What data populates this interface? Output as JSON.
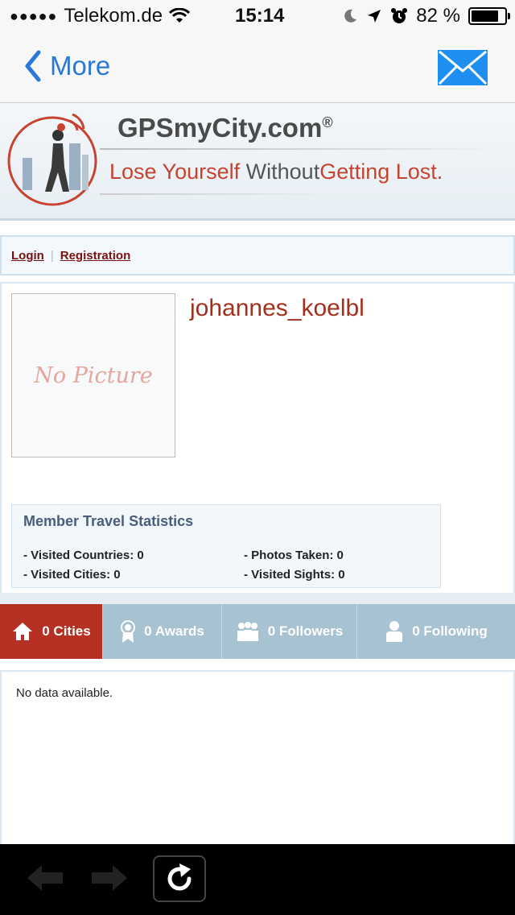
{
  "status_bar": {
    "carrier": "Telekom.de",
    "time": "15:14",
    "battery_percent_label": "82 %",
    "battery_level": 0.82
  },
  "nav": {
    "back_label": "More",
    "mail_icon": "mail-icon"
  },
  "banner": {
    "brand": "GPSmyCity.com",
    "brand_mark": "®",
    "tagline_start": "Lose Yourself",
    "tagline_mid": "Without",
    "tagline_end": "Getting Lost."
  },
  "auth": {
    "login_label": "Login",
    "separator": "|",
    "registration_label": "Registration"
  },
  "profile": {
    "no_picture_label": "No Picture",
    "username": "johannes_koelbl",
    "stats_title": "Member Travel Statistics",
    "visited_countries": "- Visited Countries: 0",
    "visited_cities": "- Visited Cities: 0",
    "photos_taken": "- Photos Taken: 0",
    "visited_sights": "- Visited Sights: 0"
  },
  "tabs": [
    {
      "label": "0 Cities",
      "icon": "home-icon",
      "active": true
    },
    {
      "label": "0 Awards",
      "icon": "award-icon",
      "active": false
    },
    {
      "label": "0 Followers",
      "icon": "followers-icon",
      "active": false
    },
    {
      "label": "0 Following",
      "icon": "following-icon",
      "active": false
    }
  ],
  "content": {
    "empty_message": "No data available."
  },
  "colors": {
    "accent_red": "#b53124",
    "ios_blue": "#2a78d8",
    "tab_bar": "#a7c2d0",
    "username_red": "#a3301f"
  }
}
